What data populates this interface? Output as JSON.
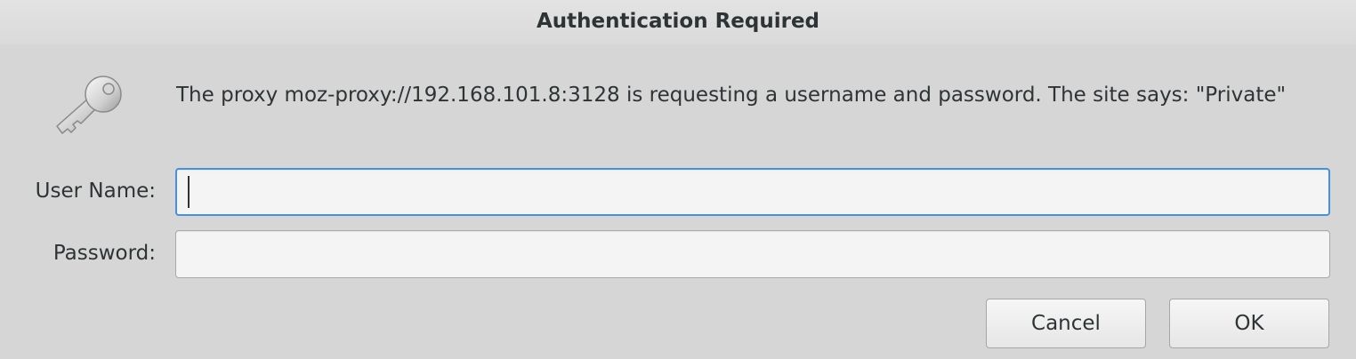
{
  "dialog": {
    "title": "Authentication Required",
    "message": "The proxy moz-proxy://192.168.101.8:3128 is requesting a username and password. The site says: \"Private\"",
    "icon": "key-icon"
  },
  "form": {
    "username_label": "User Name:",
    "username_value": "",
    "password_label": "Password:",
    "password_value": ""
  },
  "buttons": {
    "cancel_label": "Cancel",
    "ok_label": "OK"
  },
  "colors": {
    "background": "#d6d6d6",
    "focus_border": "#4a90d9",
    "text": "#2e3436"
  }
}
